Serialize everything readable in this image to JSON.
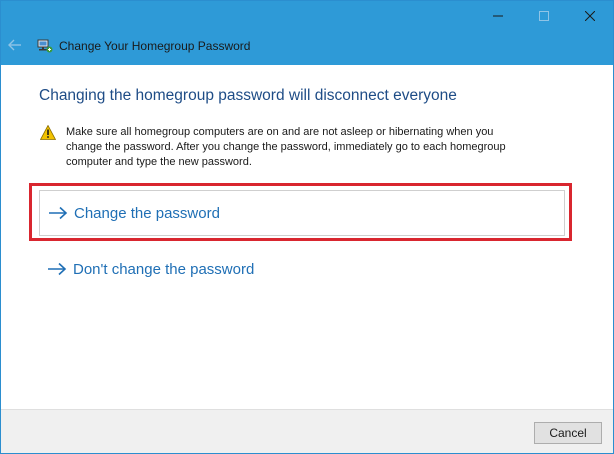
{
  "window": {
    "title": "Change Your Homegroup Password",
    "title_icon": "homegroup-network-icon",
    "caption_buttons": [
      "minimize-icon",
      "maximize-icon",
      "close-icon"
    ],
    "back_icon": "back-arrow-icon"
  },
  "main": {
    "heading": "Changing the homegroup password will disconnect everyone",
    "warning": {
      "icon": "warning-icon",
      "lines": [
        "Make sure all homegroup computers are on and are not asleep or hibernating when you",
        "change the password. After you change the password, immediately go to each homegroup",
        "computer and type the new password."
      ]
    },
    "options": [
      {
        "label": "Change the password",
        "icon": "right-arrow-icon",
        "highlighted": true
      },
      {
        "label": "Don't change the password",
        "icon": "right-arrow-icon",
        "highlighted": false
      }
    ]
  },
  "footer": {
    "cancel_label": "Cancel"
  },
  "colors": {
    "titlebar": "#2e9ad7",
    "heading": "#1e4c86",
    "link": "#1f6fb5",
    "highlight": "#d9262f",
    "warning": "#f2c200"
  }
}
